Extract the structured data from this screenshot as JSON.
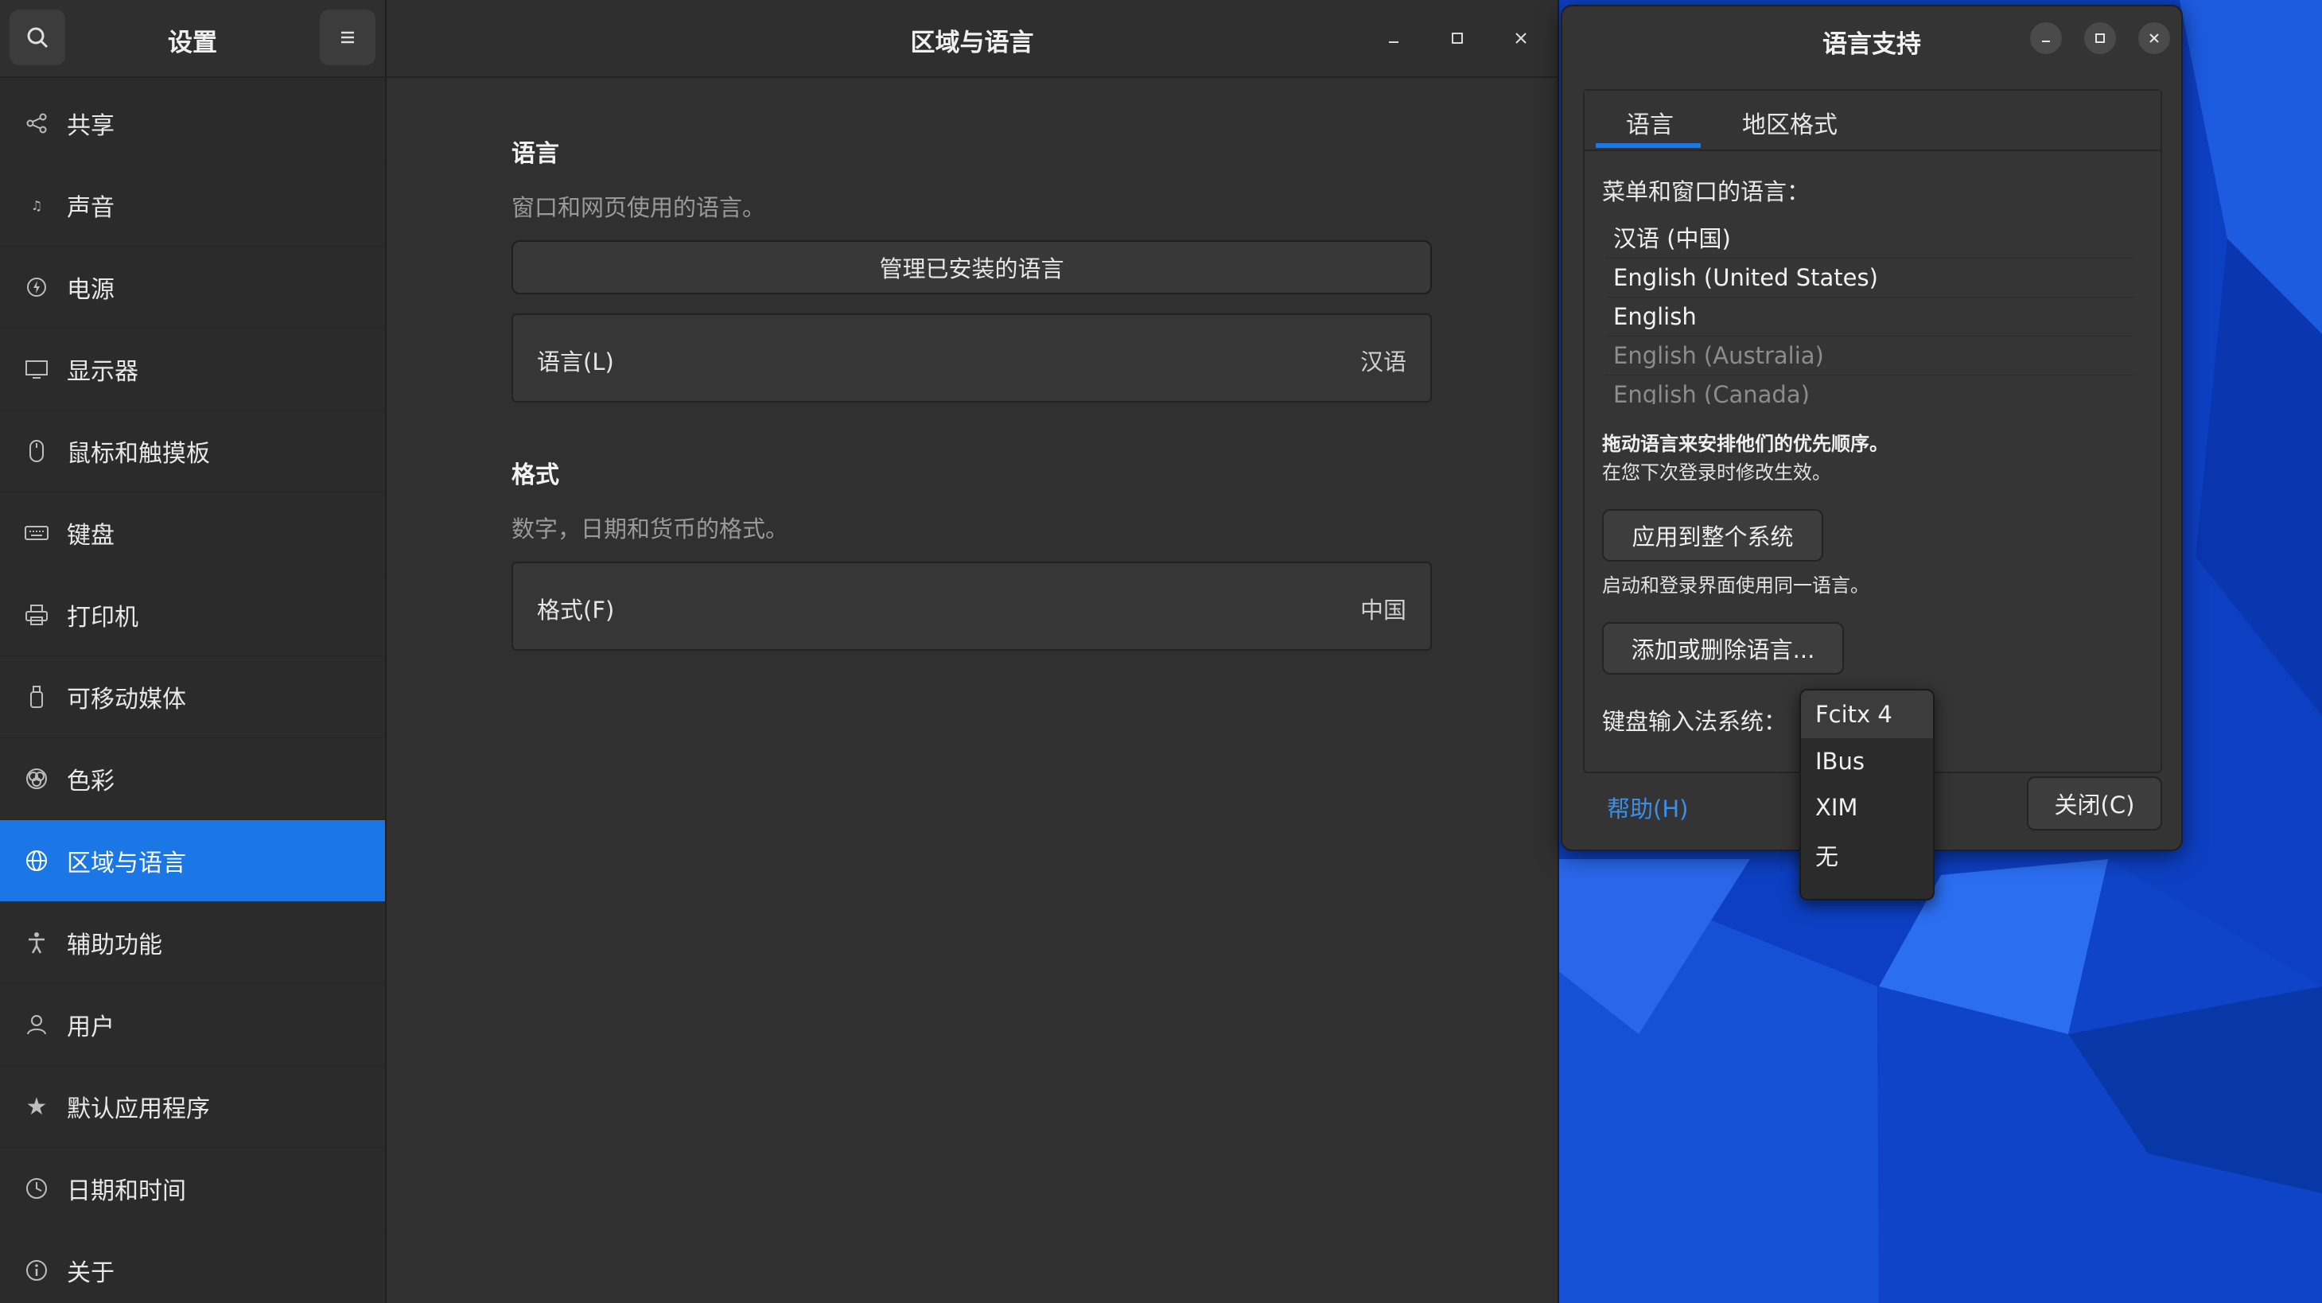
{
  "settings": {
    "sidebar_title": "设置",
    "nav": [
      {
        "label": "共享",
        "icon": "share-icon"
      },
      {
        "label": "声音",
        "icon": "music-note-icon"
      },
      {
        "label": "电源",
        "icon": "power-icon"
      },
      {
        "label": "显示器",
        "icon": "display-icon"
      },
      {
        "label": "鼠标和触摸板",
        "icon": "mouse-icon"
      },
      {
        "label": "键盘",
        "icon": "keyboard-icon"
      },
      {
        "label": "打印机",
        "icon": "printer-icon"
      },
      {
        "label": "可移动媒体",
        "icon": "usb-drive-icon"
      },
      {
        "label": "色彩",
        "icon": "color-icon"
      },
      {
        "label": "区域与语言",
        "icon": "globe-icon",
        "active": true
      },
      {
        "label": "辅助功能",
        "icon": "accessibility-icon"
      },
      {
        "label": "用户",
        "icon": "user-icon"
      },
      {
        "label": "默认应用程序",
        "icon": "star-icon"
      },
      {
        "label": "日期和时间",
        "icon": "clock-icon"
      },
      {
        "label": "关于",
        "icon": "info-icon"
      }
    ],
    "main_title": "区域与语言",
    "language_section": {
      "title": "语言",
      "subtitle": "窗口和网页使用的语言。",
      "manage_button": "管理已安装的语言",
      "row_label": "语言(L)",
      "row_value": "汉语"
    },
    "format_section": {
      "title": "格式",
      "subtitle": "数字，日期和货币的格式。",
      "row_label": "格式(F)",
      "row_value": "中国"
    }
  },
  "language_support": {
    "title": "语言支持",
    "tabs": [
      "语言",
      "地区格式"
    ],
    "menu_lang_label": "菜单和窗口的语言：",
    "languages": [
      {
        "name": "汉语 (中国)",
        "dim": false
      },
      {
        "name": "English (United States)",
        "dim": false
      },
      {
        "name": "English",
        "dim": false
      },
      {
        "name": "English (Australia)",
        "dim": true
      },
      {
        "name": "English (Canada)",
        "dim": true
      }
    ],
    "drag_hint": "拖动语言来安排他们的优先顺序。",
    "next_login": "在您下次登录时修改生效。",
    "apply_button": "应用到整个系统",
    "same_lang_note": "启动和登录界面使用同一语言。",
    "add_remove_button": "添加或删除语言...",
    "keyboard_label": "键盘输入法系统：",
    "help_link": "帮助(H)",
    "close_button": "关闭(C)"
  },
  "im_dropdown": {
    "options": [
      "Fcitx 4",
      "IBus",
      "XIM",
      "无"
    ],
    "selected": "Fcitx 4"
  },
  "colors": {
    "accent": "#1b77e6",
    "link": "#3b8eea",
    "wallpaper": "#0b3fbf"
  }
}
